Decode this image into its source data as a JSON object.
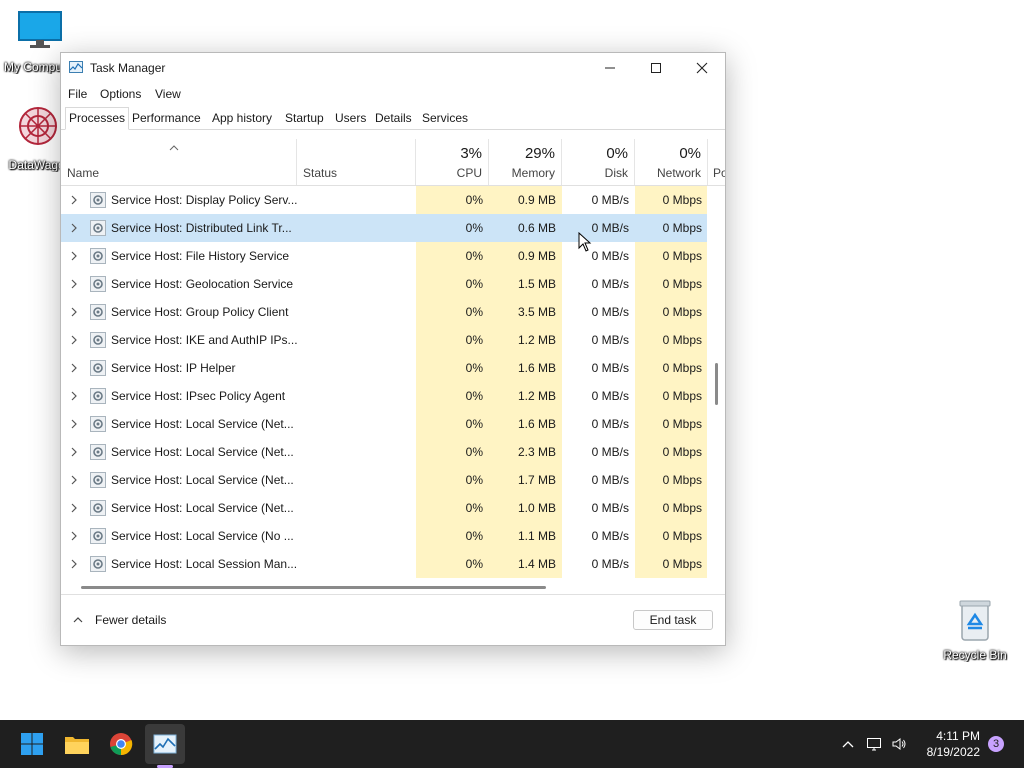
{
  "desktop": {
    "icons": [
      {
        "label": "My Computer"
      },
      {
        "label": "DataWagon"
      },
      {
        "label": "Recycle Bin"
      }
    ]
  },
  "window": {
    "title": "Task Manager",
    "menu": [
      "File",
      "Options",
      "View"
    ],
    "tabs": [
      "Processes",
      "Performance",
      "App history",
      "Startup",
      "Users",
      "Details",
      "Services"
    ],
    "active_tab": "Processes",
    "columns": {
      "name": "Name",
      "status": "Status",
      "cpu": {
        "pct": "3%",
        "label": "CPU"
      },
      "memory": {
        "pct": "29%",
        "label": "Memory"
      },
      "disk": {
        "pct": "0%",
        "label": "Disk"
      },
      "network": {
        "pct": "0%",
        "label": "Network"
      },
      "power": "Po"
    },
    "rows": [
      {
        "name": "Service Host: Display Policy Serv...",
        "cpu": "0%",
        "memory": "0.9 MB",
        "disk": "0 MB/s",
        "network": "0 Mbps"
      },
      {
        "name": "Service Host: Distributed Link Tr...",
        "cpu": "0%",
        "memory": "0.6 MB",
        "disk": "0 MB/s",
        "network": "0 Mbps",
        "selected": true
      },
      {
        "name": "Service Host: File History Service",
        "cpu": "0%",
        "memory": "0.9 MB",
        "disk": "0 MB/s",
        "network": "0 Mbps"
      },
      {
        "name": "Service Host: Geolocation Service",
        "cpu": "0%",
        "memory": "1.5 MB",
        "disk": "0 MB/s",
        "network": "0 Mbps"
      },
      {
        "name": "Service Host: Group Policy Client",
        "cpu": "0%",
        "memory": "3.5 MB",
        "disk": "0 MB/s",
        "network": "0 Mbps"
      },
      {
        "name": "Service Host: IKE and AuthIP IPs...",
        "cpu": "0%",
        "memory": "1.2 MB",
        "disk": "0 MB/s",
        "network": "0 Mbps"
      },
      {
        "name": "Service Host: IP Helper",
        "cpu": "0%",
        "memory": "1.6 MB",
        "disk": "0 MB/s",
        "network": "0 Mbps"
      },
      {
        "name": "Service Host: IPsec Policy Agent",
        "cpu": "0%",
        "memory": "1.2 MB",
        "disk": "0 MB/s",
        "network": "0 Mbps"
      },
      {
        "name": "Service Host: Local Service (Net...",
        "cpu": "0%",
        "memory": "1.6 MB",
        "disk": "0 MB/s",
        "network": "0 Mbps"
      },
      {
        "name": "Service Host: Local Service (Net...",
        "cpu": "0%",
        "memory": "2.3 MB",
        "disk": "0 MB/s",
        "network": "0 Mbps"
      },
      {
        "name": "Service Host: Local Service (Net...",
        "cpu": "0%",
        "memory": "1.7 MB",
        "disk": "0 MB/s",
        "network": "0 Mbps"
      },
      {
        "name": "Service Host: Local Service (Net...",
        "cpu": "0%",
        "memory": "1.0 MB",
        "disk": "0 MB/s",
        "network": "0 Mbps"
      },
      {
        "name": "Service Host: Local Service (No ...",
        "cpu": "0%",
        "memory": "1.1 MB",
        "disk": "0 MB/s",
        "network": "0 Mbps"
      },
      {
        "name": "Service Host: Local Session Man...",
        "cpu": "0%",
        "memory": "1.4 MB",
        "disk": "0 MB/s",
        "network": "0 Mbps"
      }
    ],
    "footer": {
      "fewer_details": "Fewer details",
      "end_task": "End task"
    }
  },
  "taskbar": {
    "apps": [
      "start-icon",
      "file-explorer-icon",
      "chrome-icon",
      "task-manager-icon"
    ],
    "clock": {
      "time": "4:11 PM",
      "date": "8/19/2022"
    },
    "notification_count": "3"
  },
  "colors": {
    "accent": "#0067c0",
    "selected_row": "#cce4f7",
    "heat_tint": "#fff4c4",
    "taskbar": "#1f1f1f"
  }
}
